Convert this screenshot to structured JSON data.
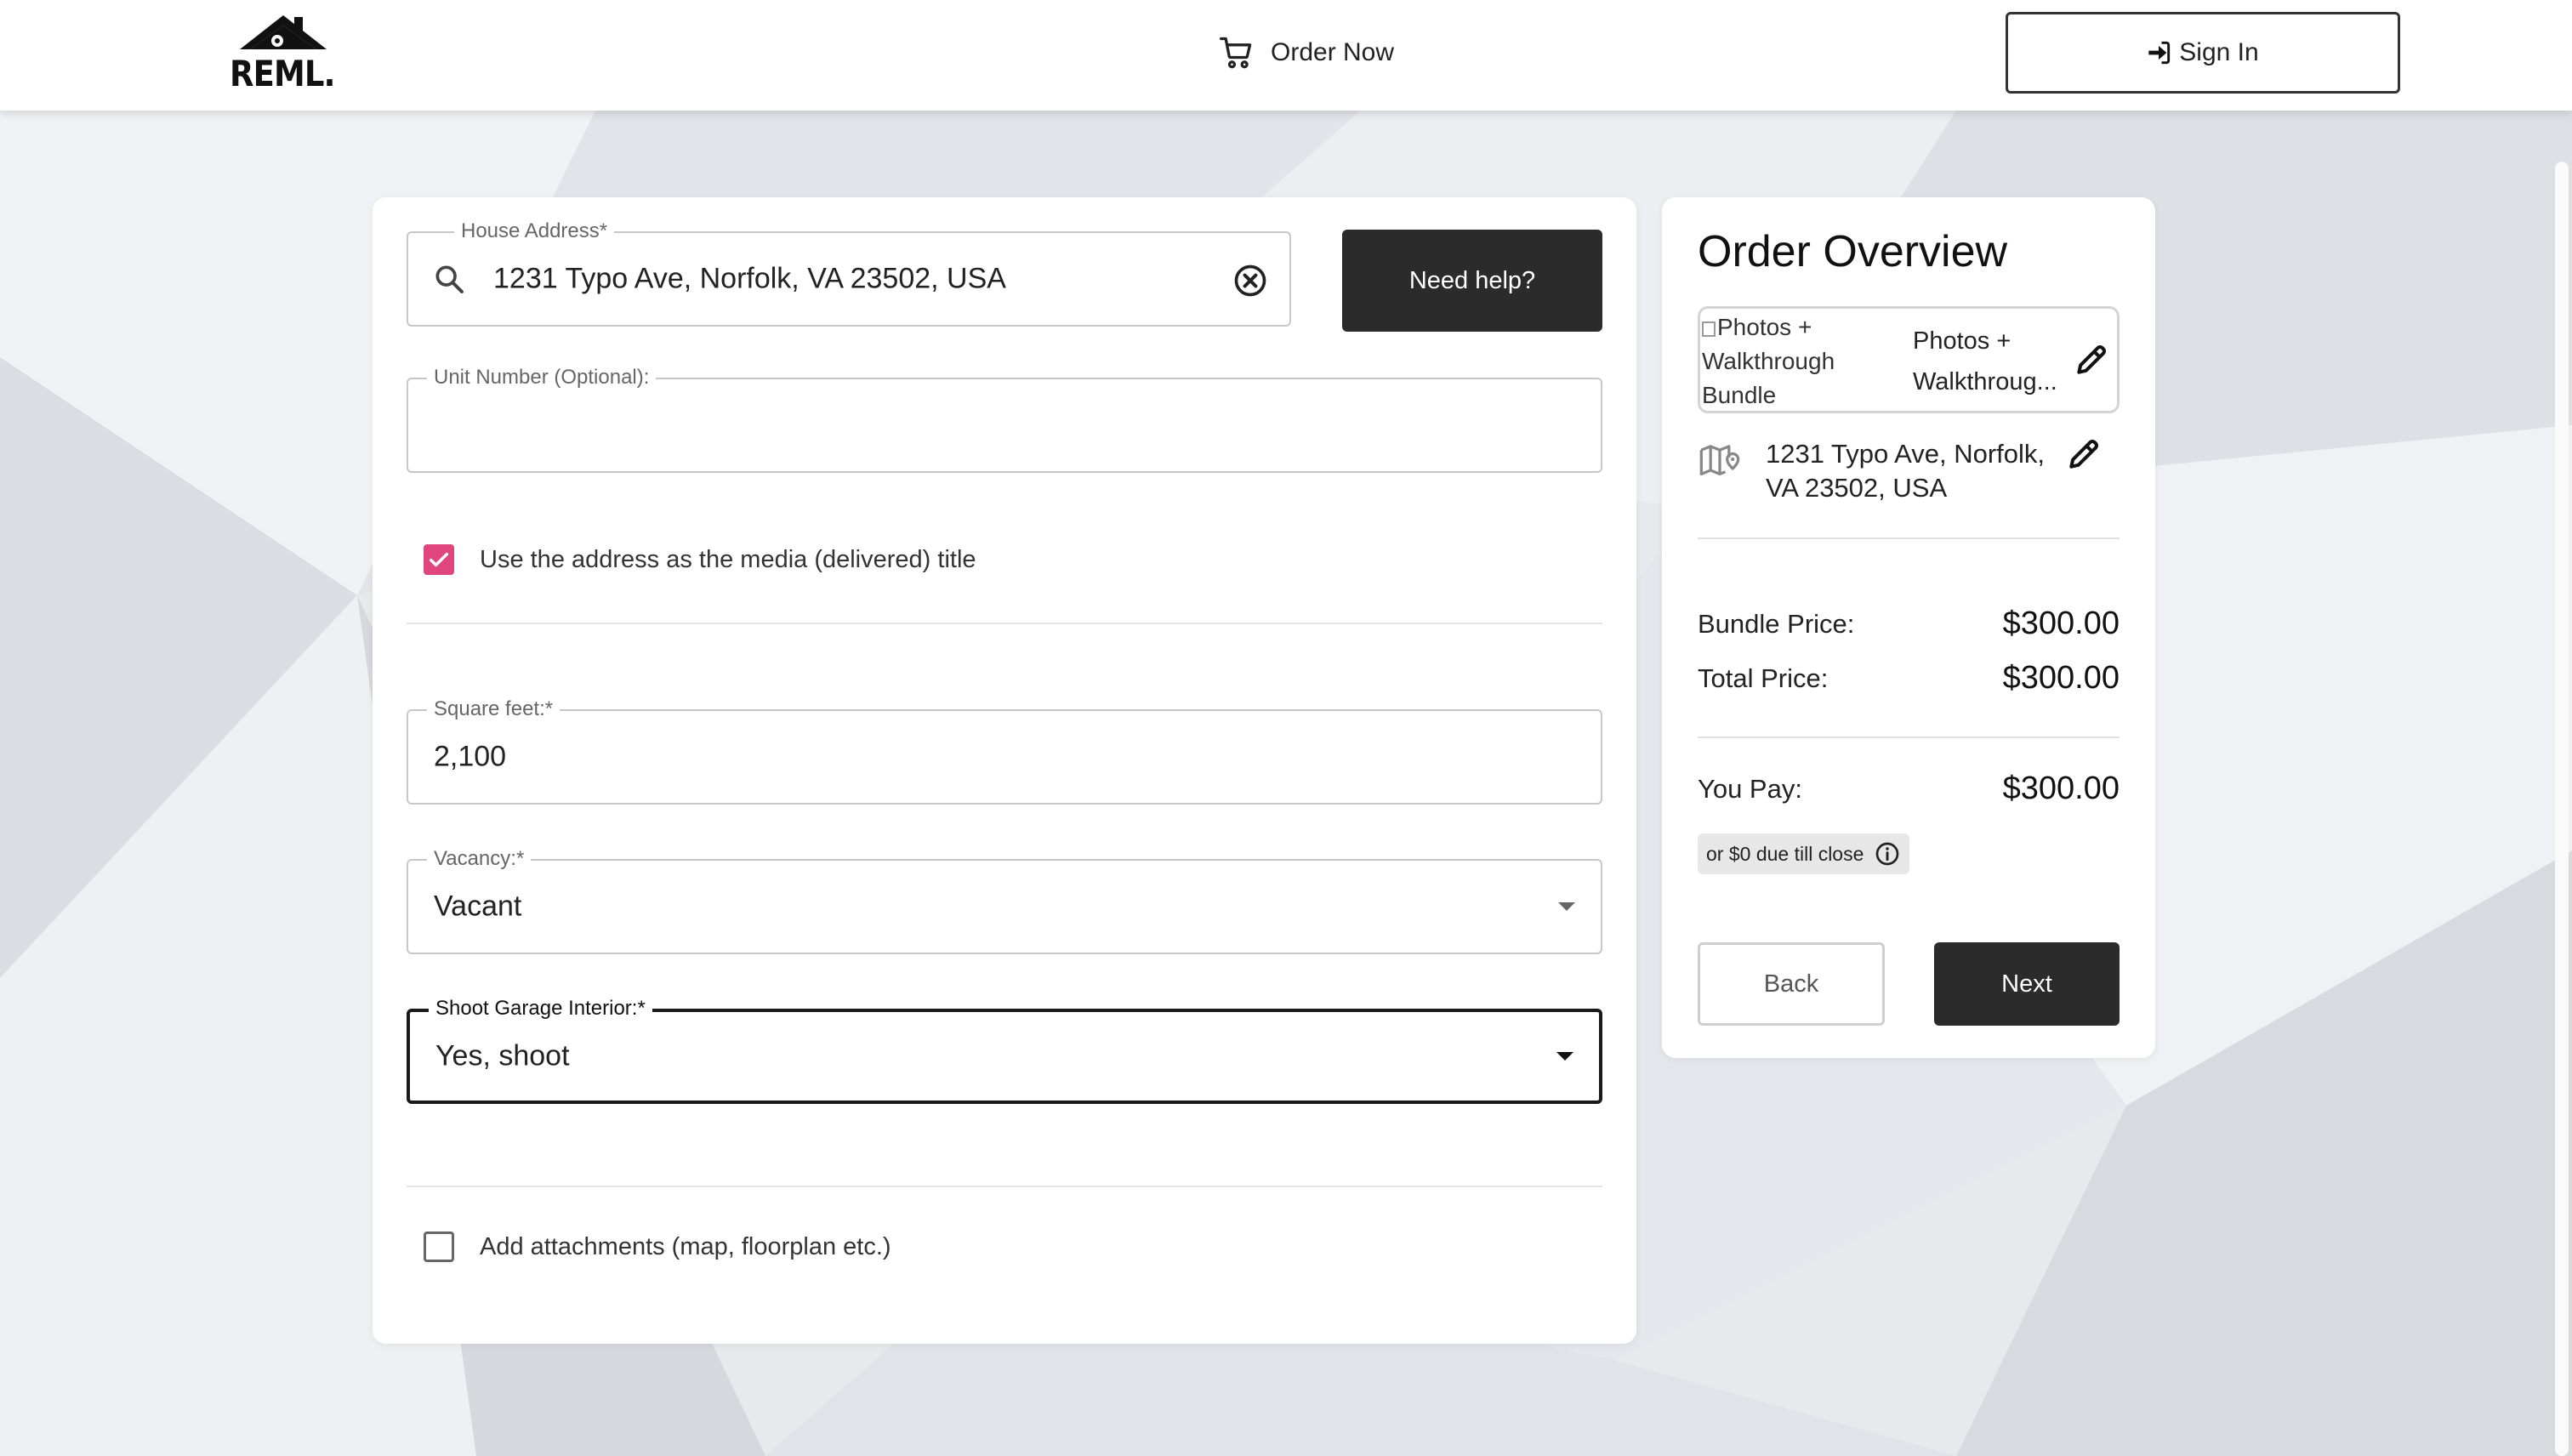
{
  "header": {
    "logo_text": "REML.",
    "order_now_label": "Order Now",
    "sign_in_label": "Sign In"
  },
  "form": {
    "house_address": {
      "label": "House Address*",
      "value": "1231 Typo Ave, Norfolk, VA 23502, USA"
    },
    "need_help_label": "Need help?",
    "unit_number": {
      "label": "Unit Number (Optional):",
      "value": ""
    },
    "use_address_title": {
      "label": "Use the address as the media (delivered) title",
      "checked": true
    },
    "square_feet": {
      "label": "Square feet:*",
      "value": "2,100"
    },
    "vacancy": {
      "label": "Vacancy:*",
      "value": "Vacant"
    },
    "shoot_garage": {
      "label": "Shoot Garage Interior:*",
      "value": "Yes, shoot"
    },
    "add_attachments": {
      "label": "Add attachments (map, floorplan etc.)",
      "checked": false
    }
  },
  "overview": {
    "title": "Order Overview",
    "bundle_image_alt": "Photos + Walkthrough Bundle",
    "bundle_name_line1": "Photos +",
    "bundle_name_line2": "Walkthroug...",
    "address": "1231 Typo Ave, Norfolk, VA 23502, USA",
    "bundle_price_label": "Bundle Price:",
    "bundle_price": "$300.00",
    "total_price_label": "Total Price:",
    "total_price": "$300.00",
    "you_pay_label": "You Pay:",
    "you_pay": "$300.00",
    "due_note": "or $0 due till close",
    "back_label": "Back",
    "next_label": "Next"
  },
  "colors": {
    "accent_pink": "#e0457b",
    "dark_button": "#2b2b2b"
  }
}
